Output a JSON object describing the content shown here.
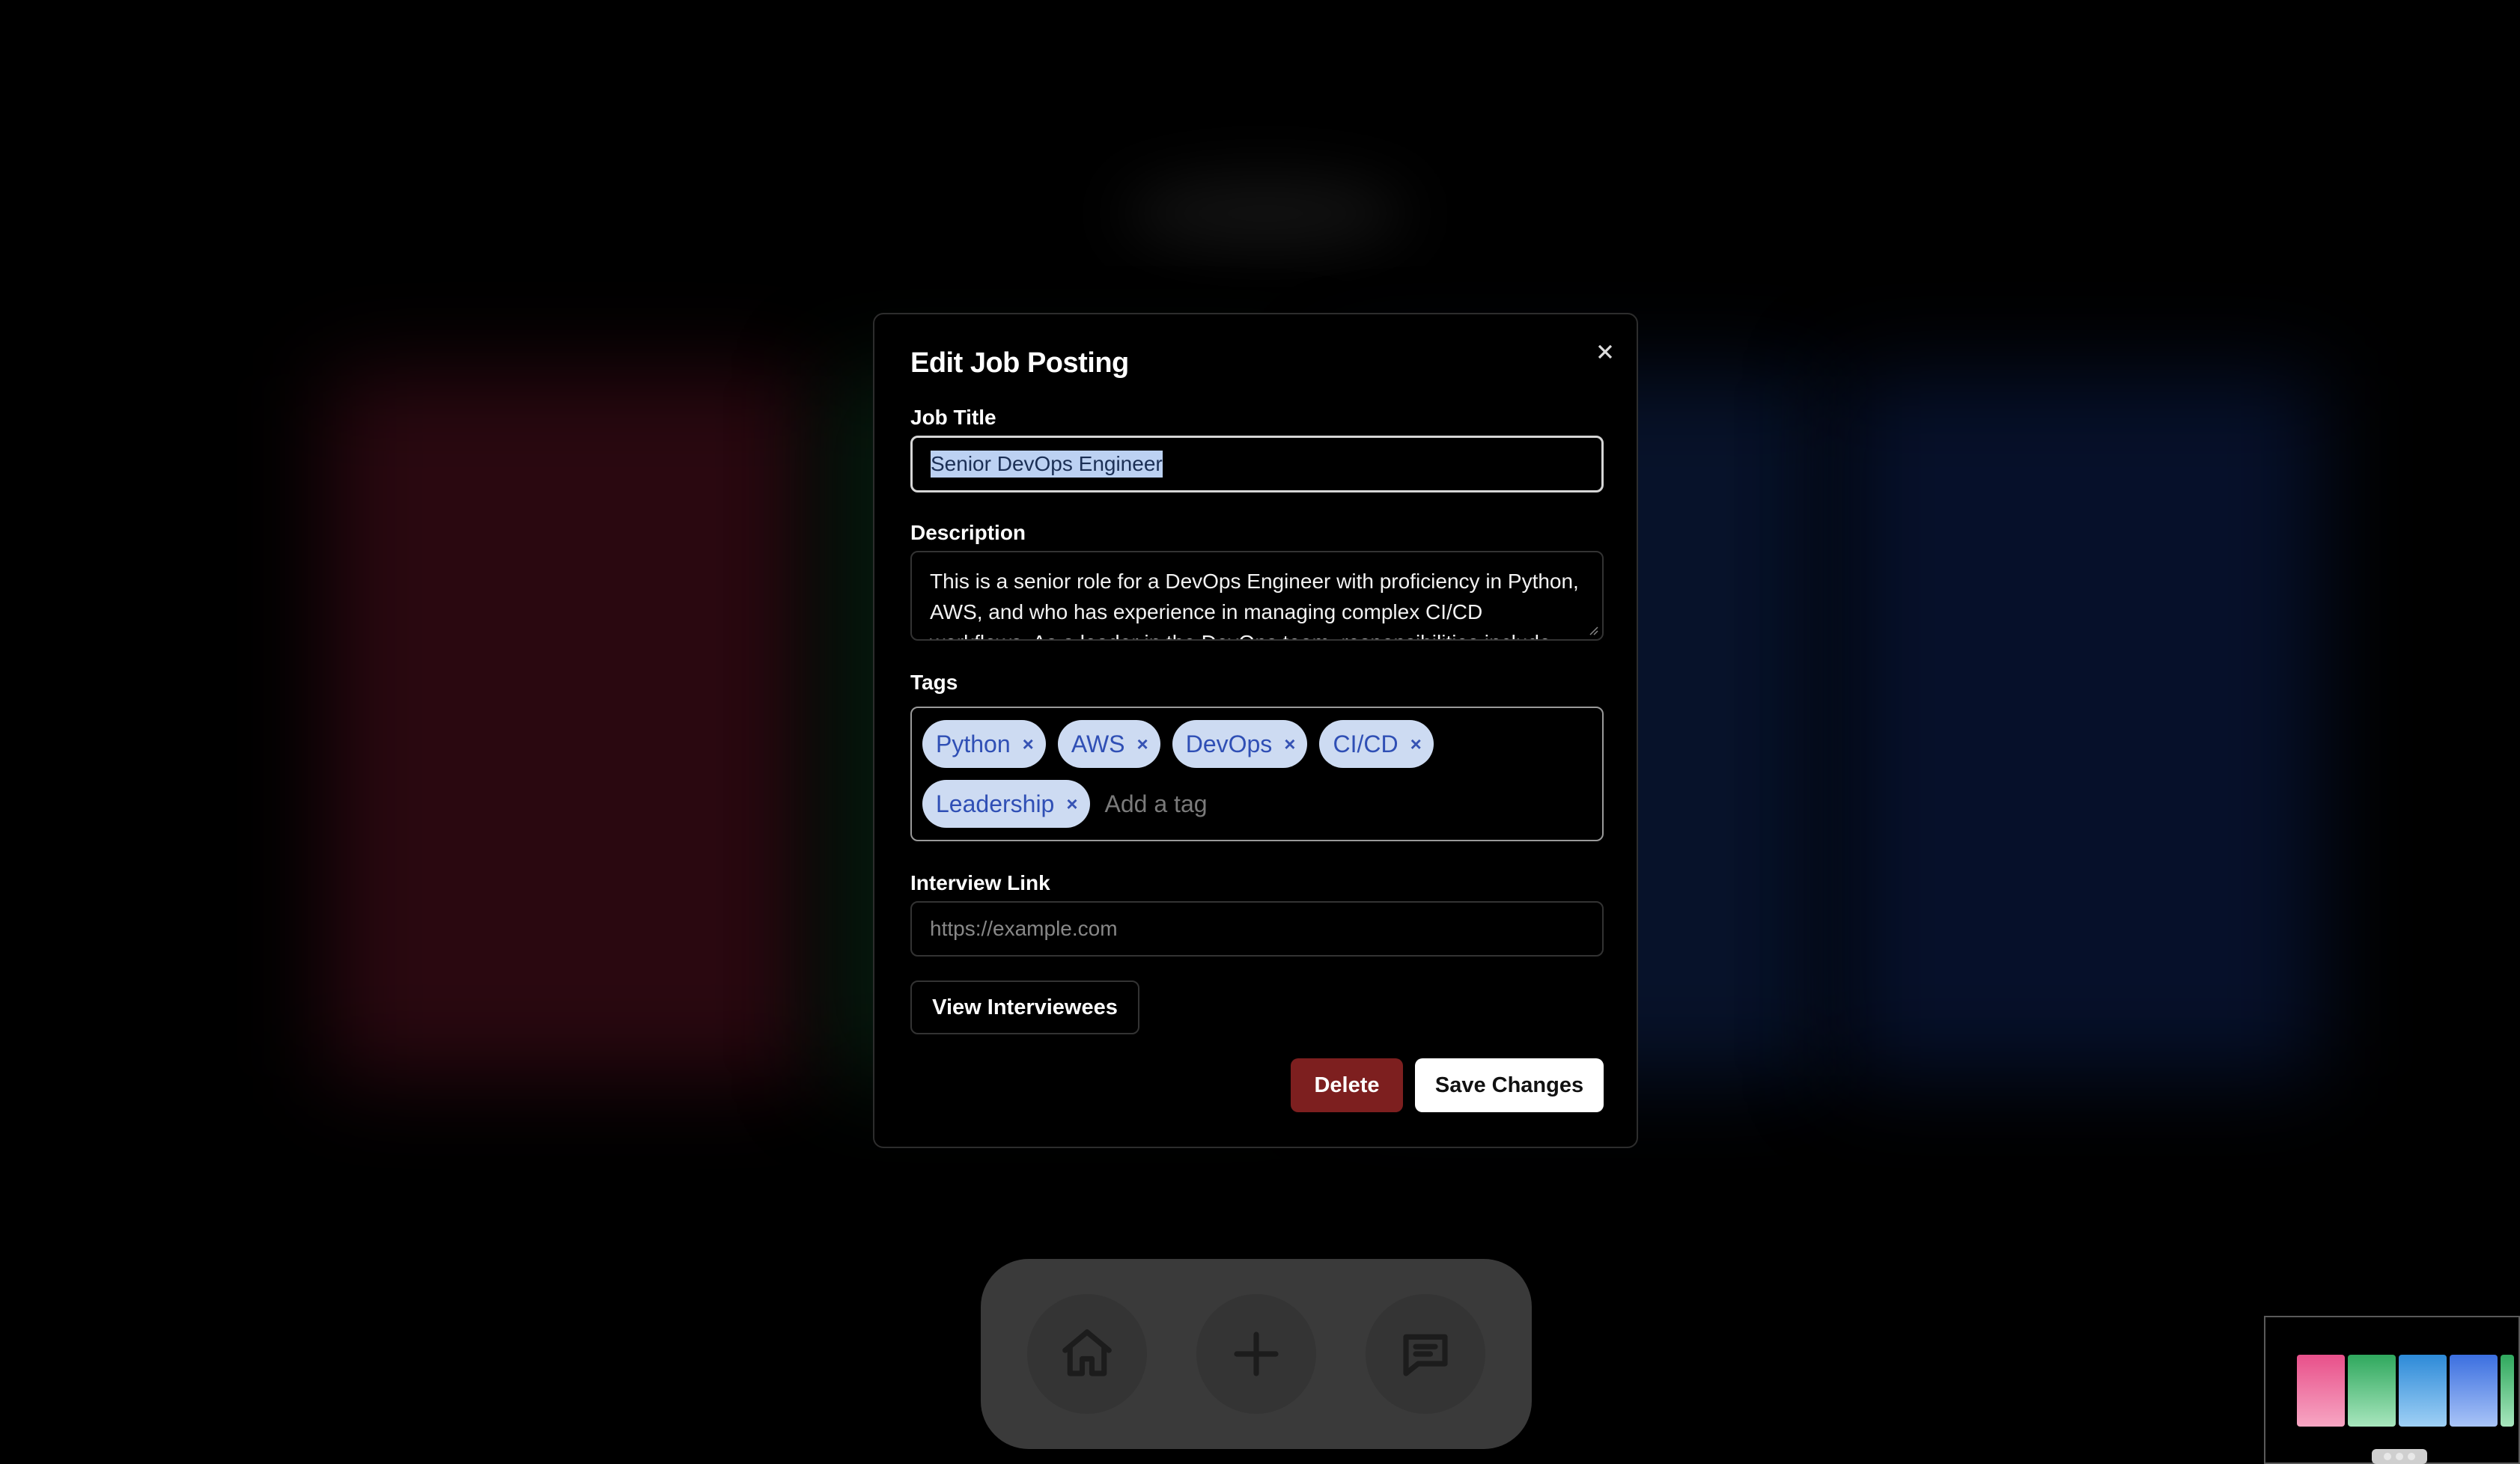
{
  "modal": {
    "title": "Edit Job Posting",
    "job_title_label": "Job Title",
    "job_title_value": "Senior DevOps Engineer",
    "description_label": "Description",
    "description_value": "This is a senior role for a DevOps Engineer with proficiency in Python, AWS, and who has experience in managing complex CI/CD workflows. As a leader in the DevOps team, responsibilities include",
    "tags_label": "Tags",
    "tags": [
      "Python",
      "AWS",
      "DevOps",
      "CI/CD",
      "Leadership"
    ],
    "tag_remove_glyph": "×",
    "tag_placeholder": "Add a tag",
    "interview_link_label": "Interview Link",
    "interview_link_placeholder": "https://example.com",
    "view_interviewees_label": "View Interviewees",
    "delete_label": "Delete",
    "save_label": "Save Changes"
  },
  "dock": {
    "icons": [
      "home-icon",
      "plus-icon",
      "chat-icon"
    ]
  },
  "colors": {
    "delete_button": "#7d1f1f",
    "tag_background": "#cddbf2",
    "tag_text": "#2f4fb5",
    "selection": "#bcd1f2"
  }
}
